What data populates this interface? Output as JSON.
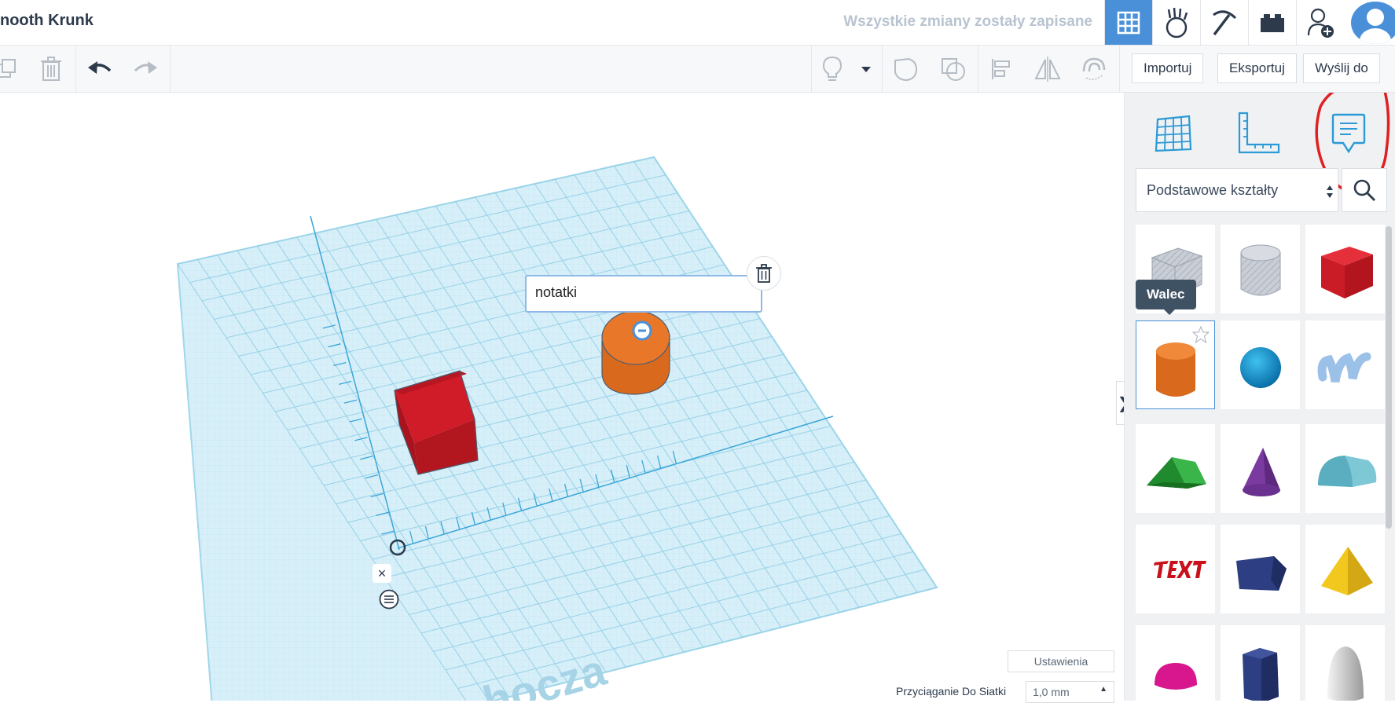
{
  "header": {
    "title": "nooth Krunk",
    "saved_status": "Wszystkie zmiany zostały zapisane",
    "nav_icons": [
      "grid-view-icon",
      "tinkercad-hand-icon",
      "pickaxe-icon",
      "bricks-icon",
      "add-user-icon",
      "avatar-icon"
    ]
  },
  "toolbar": {
    "import_label": "Importuj",
    "export_label": "Eksportuj",
    "send_label": "Wyślij do"
  },
  "panel": {
    "category_select": "Podstawowe kształty",
    "tooltip": "Walec",
    "shapes": [
      "box-hole",
      "cylinder-hole",
      "box",
      "cylinder",
      "sphere",
      "scribble",
      "roof",
      "cone",
      "round-roof",
      "text",
      "prism",
      "pyramid",
      "half-sphere",
      "polygon",
      "paraboloid"
    ]
  },
  "canvas": {
    "note_text": "notatki",
    "workplane_watermark": "hocza",
    "settings_label": "Ustawienia",
    "snap_label": "Przyciąganie Do Siatki",
    "snap_value": "1,0 mm"
  },
  "colors": {
    "accent": "#4a90d9",
    "grid": "#a9dcef",
    "cube": "#d91f2c",
    "cylinder": "#e8772a",
    "annotation": "#e02020"
  }
}
